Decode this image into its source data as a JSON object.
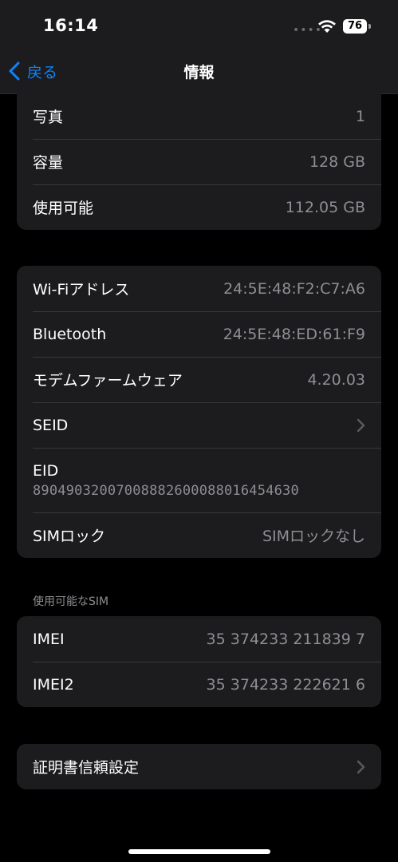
{
  "status": {
    "time": "16:14",
    "battery": "76"
  },
  "nav": {
    "back_label": "戻る",
    "title": "情報"
  },
  "group1": [
    {
      "label": "写真",
      "value": "1"
    },
    {
      "label": "容量",
      "value": "128 GB"
    },
    {
      "label": "使用可能",
      "value": "112.05 GB"
    }
  ],
  "group2": {
    "wifi": {
      "label": "Wi-Fiアドレス",
      "value": "24:5E:48:F2:C7:A6"
    },
    "bluetooth": {
      "label": "Bluetooth",
      "value": "24:5E:48:ED:61:F9"
    },
    "modem": {
      "label": "モデムファームウェア",
      "value": "4.20.03"
    },
    "seid": {
      "label": "SEID"
    },
    "eid": {
      "label": "EID",
      "value": "89049032007008882600088016454630"
    },
    "simlock": {
      "label": "SIMロック",
      "value": "SIMロックなし"
    }
  },
  "sim_section": {
    "header": "使用可能なSIM",
    "rows": [
      {
        "label": "IMEI",
        "value": "35 374233 211839 7"
      },
      {
        "label": "IMEI2",
        "value": "35 374233 222621 6"
      }
    ]
  },
  "cert": {
    "label": "証明書信頼設定"
  },
  "icons": {
    "back": "chevron-left-icon",
    "disclosure": "chevron-right-icon",
    "wifi": "wifi-icon",
    "battery": "battery-icon"
  },
  "colors": {
    "accent": "#0a84ff",
    "background": "#000000",
    "cell": "#1c1c1e",
    "secondary_text": "#8e8e93"
  }
}
